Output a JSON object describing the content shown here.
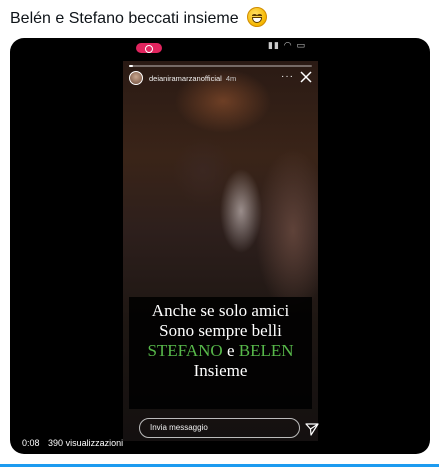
{
  "tweet": {
    "text": "Belén e Stefano beccati insieme",
    "emoji": "grinning-face-with-smiling-eyes"
  },
  "story": {
    "username": "deianiramarzanofficial",
    "time_ago": "4m",
    "more": "···",
    "progress_fraction": 0.02,
    "caption": {
      "line1": "Anche se solo amici",
      "line2": "Sono sempre belli",
      "name1": "STEFANO",
      "joiner": "e",
      "name2": "BELEN",
      "line4": "Insieme"
    },
    "caption_name_color": "#57b84a",
    "reply_placeholder": "Invia messaggio"
  },
  "video": {
    "elapsed": "0:08",
    "views": "390 visualizzazioni"
  },
  "colors": {
    "record_indicator": "#e0245e",
    "accent": "#1d9bf0"
  }
}
